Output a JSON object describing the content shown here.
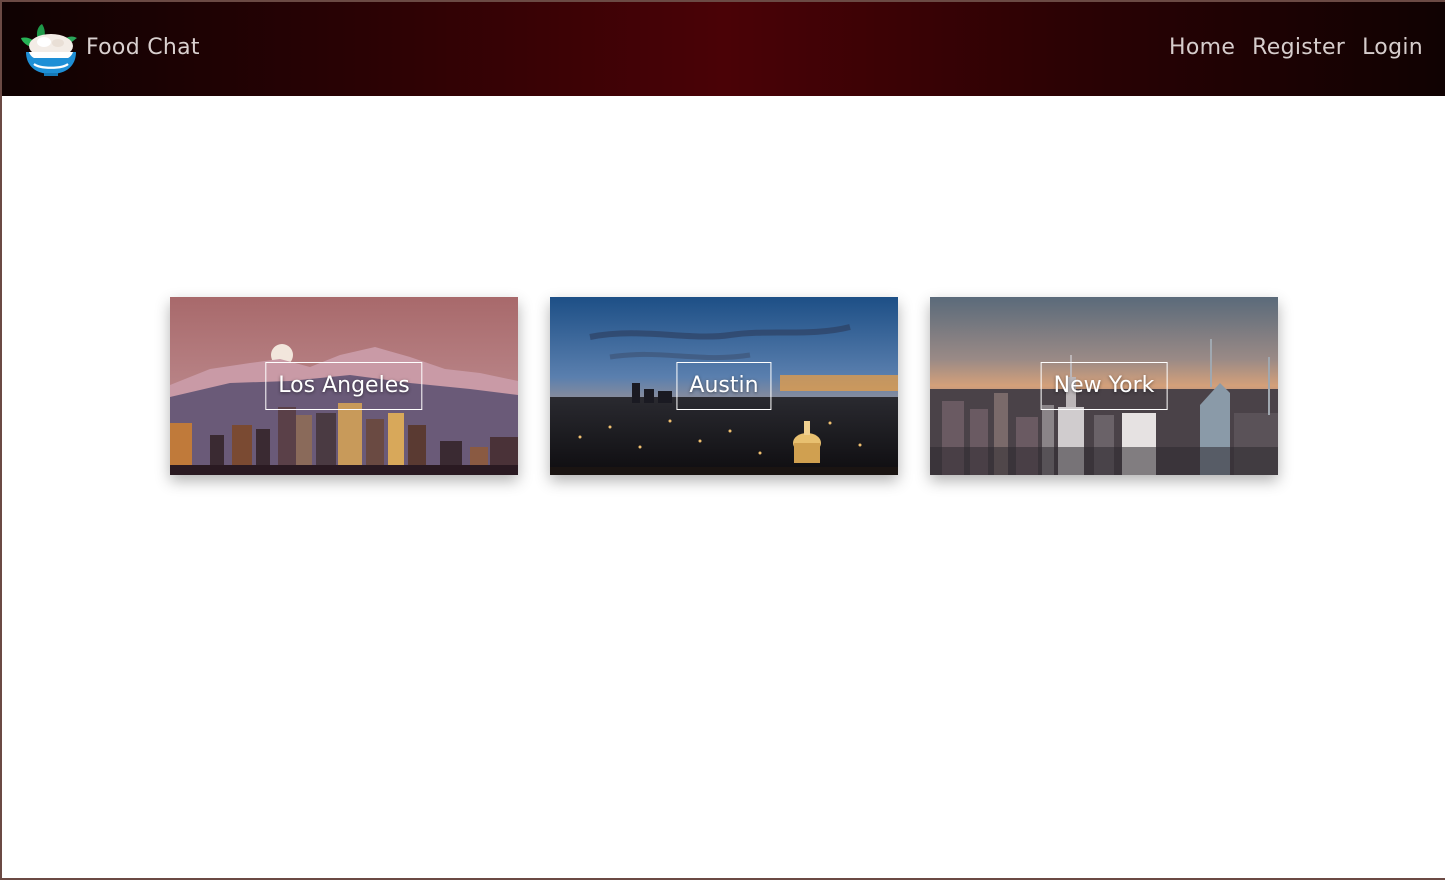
{
  "app": {
    "title": "Food Chat"
  },
  "nav": {
    "links": [
      {
        "label": "Home"
      },
      {
        "label": "Register"
      },
      {
        "label": "Login"
      }
    ]
  },
  "cities": [
    {
      "label": "Los Angeles"
    },
    {
      "label": "Austin"
    },
    {
      "label": "New York"
    }
  ],
  "colors": {
    "navbar_center": "#4a0206",
    "navbar_edge": "#0f0202",
    "nav_text": "#d6cdcc",
    "page_background": "#ffffff"
  },
  "icons": {
    "brand": "food-bowl-logo-icon"
  }
}
